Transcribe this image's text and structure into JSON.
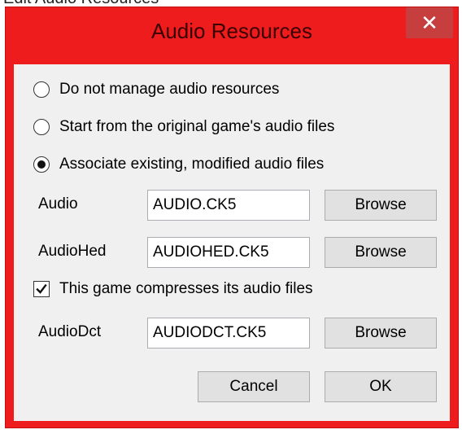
{
  "top_strip_text": "Edit Audio Resources",
  "window": {
    "title": "Audio Resources",
    "close_glyph": "✕",
    "accent_color": "#ee1c1c"
  },
  "options": {
    "no_manage": "Do not manage audio resources",
    "start_original": "Start from the original game's audio files",
    "associate_existing": "Associate existing, modified audio files",
    "selected": "associate_existing"
  },
  "fields": {
    "audio": {
      "label": "Audio",
      "value": "AUDIO.CK5",
      "button": "Browse"
    },
    "audiohed": {
      "label": "AudioHed",
      "value": "AUDIOHED.CK5",
      "button": "Browse"
    },
    "audiodct": {
      "label": "AudioDct",
      "value": "AUDIODCT.CK5",
      "button": "Browse"
    }
  },
  "compress_checkbox": {
    "label": "This game compresses its audio files",
    "checked": true
  },
  "buttons": {
    "cancel": "Cancel",
    "ok": "OK"
  }
}
